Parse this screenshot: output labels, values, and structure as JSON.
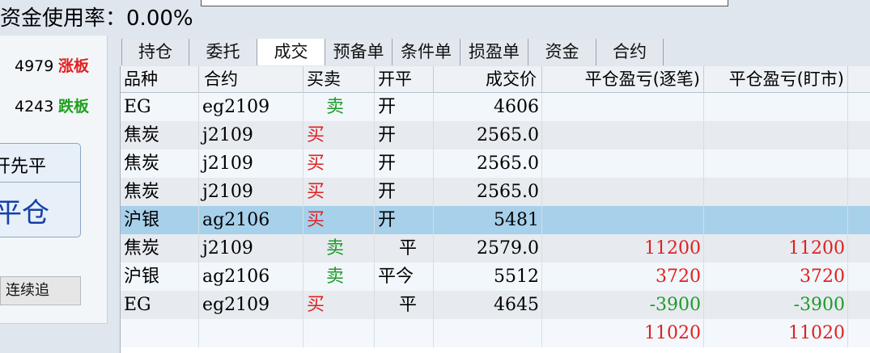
{
  "fund_usage": {
    "label": "资金使用率：",
    "value": "0.00%"
  },
  "price_limits": {
    "up": {
      "value": "4979",
      "label": "涨板"
    },
    "down": {
      "value": "4243",
      "label": "跌板"
    }
  },
  "close_first": {
    "line1": "开先平",
    "line2": "平仓"
  },
  "chase_button": "连续追",
  "tabs": [
    "持仓",
    "委托",
    "成交",
    "预备单",
    "条件单",
    "损盈单",
    "资金",
    "合约"
  ],
  "active_tab": "成交",
  "columns": [
    "品种",
    "合约",
    "买卖",
    "开平",
    "成交价",
    "平仓盈亏(逐笔)",
    "平仓盈亏(盯市)"
  ],
  "trades": [
    {
      "product": "EG",
      "contract": "eg2109",
      "side": "卖",
      "open_close": "开",
      "price": "4606",
      "pnl_trade": "",
      "pnl_mtm": ""
    },
    {
      "product": "焦炭",
      "contract": "j2109",
      "side": "买",
      "open_close": "开",
      "price": "2565.0",
      "pnl_trade": "",
      "pnl_mtm": ""
    },
    {
      "product": "焦炭",
      "contract": "j2109",
      "side": "买",
      "open_close": "开",
      "price": "2565.0",
      "pnl_trade": "",
      "pnl_mtm": ""
    },
    {
      "product": "焦炭",
      "contract": "j2109",
      "side": "买",
      "open_close": "开",
      "price": "2565.0",
      "pnl_trade": "",
      "pnl_mtm": ""
    },
    {
      "product": "沪银",
      "contract": "ag2106",
      "side": "买",
      "open_close": "开",
      "price": "5481",
      "pnl_trade": "",
      "pnl_mtm": "",
      "selected": true
    },
    {
      "product": "焦炭",
      "contract": "j2109",
      "side": "卖",
      "open_close": "平",
      "price": "2579.0",
      "pnl_trade": "11200",
      "pnl_mtm": "11200"
    },
    {
      "product": "沪银",
      "contract": "ag2106",
      "side": "卖",
      "open_close": "平今",
      "price": "5512",
      "pnl_trade": "3720",
      "pnl_mtm": "3720"
    },
    {
      "product": "EG",
      "contract": "eg2109",
      "side": "买",
      "open_close": "平",
      "price": "4645",
      "pnl_trade": "-3900",
      "pnl_mtm": "-3900"
    }
  ],
  "totals": {
    "pnl_trade": "11020",
    "pnl_mtm": "11020"
  },
  "colors": {
    "buy": "#e02020",
    "sell": "#1f9a2a",
    "selected_row": "#a7d0ea"
  }
}
